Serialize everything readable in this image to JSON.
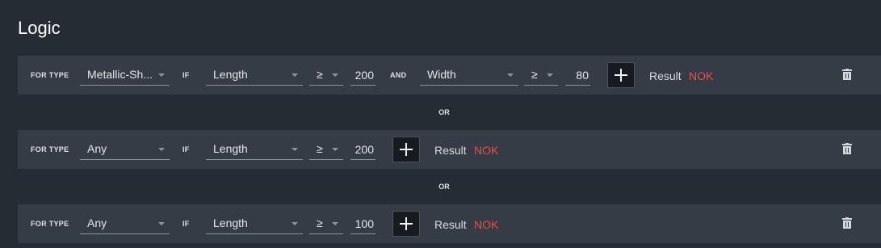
{
  "title": "Logic",
  "labels": {
    "for_type": "FOR TYPE",
    "if": "IF",
    "and": "AND",
    "or": "OR",
    "result": "Result"
  },
  "colors": {
    "nok": "#e0524c",
    "row_bg": "#353c45",
    "page_bg": "#262c34"
  },
  "icons": {
    "add": "plus-icon",
    "delete": "trash-icon",
    "dropdown": "caret-down-icon"
  },
  "rules": [
    {
      "type": "Metallic-Sh...",
      "cond1": {
        "field": "Length",
        "op": "≥",
        "value": "200"
      },
      "cond2": {
        "field": "Width",
        "op": "≥",
        "value": "80"
      },
      "result": "NOK"
    },
    {
      "type": "Any",
      "cond1": {
        "field": "Length",
        "op": "≥",
        "value": "200"
      },
      "result": "NOK"
    },
    {
      "type": "Any",
      "cond1": {
        "field": "Length",
        "op": "≥",
        "value": "100"
      },
      "result": "NOK"
    }
  ]
}
